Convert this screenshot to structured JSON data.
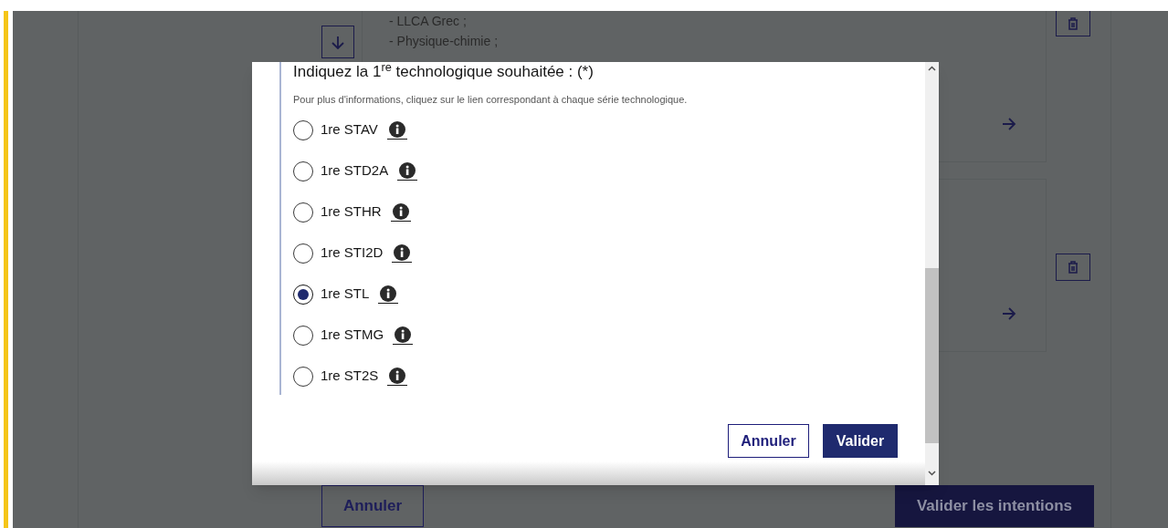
{
  "page": {
    "card_lines": [
      "- LLCA Grec ;",
      "- Physique-chimie ;"
    ],
    "buttons": {
      "cancel": "Annuler",
      "submit": "Valider les intentions"
    }
  },
  "modal": {
    "title": "Indiquez la 1$^{re}$ technologique souhaitée : (*)",
    "hint": "Pour plus d'informations, cliquez sur le lien correspondant à chaque série technologique.",
    "options": [
      {
        "label": "1re STAV",
        "selected": false
      },
      {
        "label": "1re STD2A",
        "selected": false
      },
      {
        "label": "1re STHR",
        "selected": false
      },
      {
        "label": "1re STI2D",
        "selected": false
      },
      {
        "label": "1re STL",
        "selected": true
      },
      {
        "label": "1re STMG",
        "selected": false
      },
      {
        "label": "1re ST2S",
        "selected": false
      }
    ],
    "buttons": {
      "cancel": "Annuler",
      "confirm": "Valider"
    }
  }
}
